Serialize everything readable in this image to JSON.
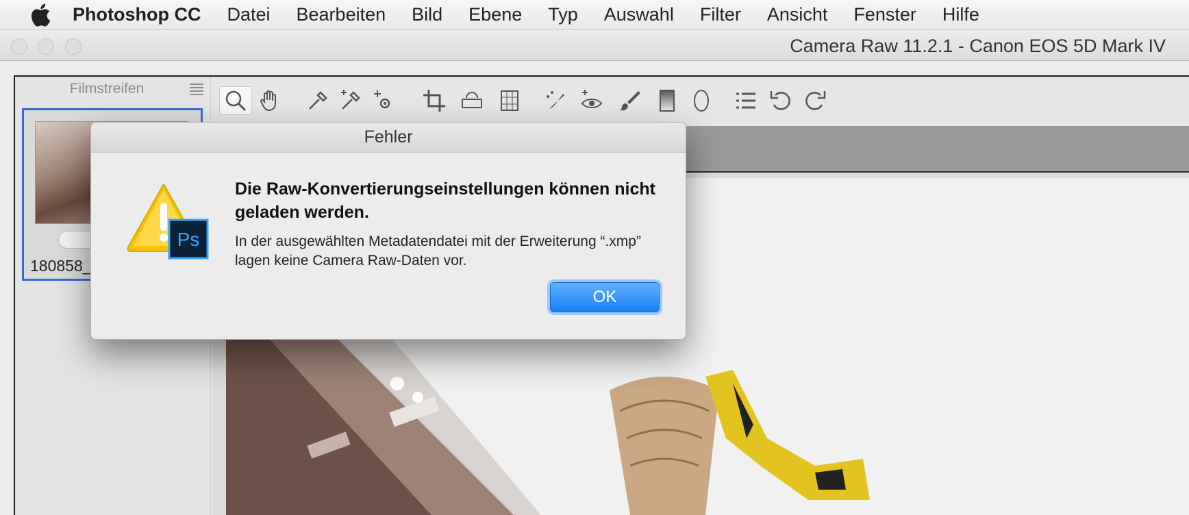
{
  "menubar": {
    "apple_icon": "apple-logo-icon",
    "app_name": "Photoshop CC",
    "items": [
      "Datei",
      "Bearbeiten",
      "Bild",
      "Ebene",
      "Typ",
      "Auswahl",
      "Filter",
      "Ansicht",
      "Fenster",
      "Hilfe"
    ]
  },
  "window": {
    "title": "Camera Raw 11.2.1  -  Canon EOS 5D Mark IV"
  },
  "filmstrip": {
    "title": "Filmstreifen",
    "menu_icon": "list-menu-icon",
    "thumb_label": "180858_",
    "rating": "•"
  },
  "toolbar": {
    "tools": [
      "zoom-icon",
      "hand-icon",
      "white-balance-icon",
      "color-sampler-icon",
      "targeted-adjustment-icon",
      "crop-icon",
      "straighten-icon",
      "transform-icon",
      "spot-removal-icon",
      "red-eye-icon",
      "adjustment-brush-icon",
      "graduated-filter-icon",
      "radial-filter-icon",
      "preferences-list-icon",
      "rotate-left-icon",
      "rotate-right-icon"
    ]
  },
  "dialog": {
    "title": "Fehler",
    "heading": "Die Raw-Konvertierungseinstellungen können nicht geladen werden.",
    "message": "In der ausgewählten Metadatendatei mit der Erweiterung “.xmp” lagen keine Camera Raw-Daten vor.",
    "ok_label": "OK",
    "icon": "warning-photoshop-icon",
    "badge": "Ps"
  },
  "colors": {
    "accent_button": "#1a7df5",
    "warning_yellow": "#f5c400",
    "ps_badge": "#0a2138",
    "ps_text": "#31a8ff"
  }
}
